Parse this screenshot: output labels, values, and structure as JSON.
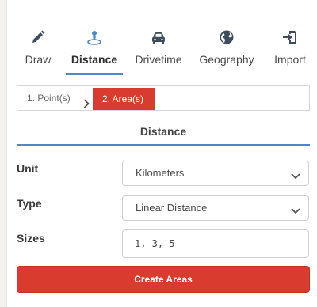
{
  "tabs": [
    {
      "label": "Draw",
      "icon": "pencil-icon"
    },
    {
      "label": "Distance",
      "icon": "map-pin-icon",
      "active": true
    },
    {
      "label": "Drivetime",
      "icon": "car-icon"
    },
    {
      "label": "Geography",
      "icon": "globe-icon"
    },
    {
      "label": "Import",
      "icon": "import-icon"
    }
  ],
  "steps": {
    "step1": "1. Point(s)",
    "step2": "2. Area(s)"
  },
  "section": {
    "title": "Distance"
  },
  "form": {
    "unit_label": "Unit",
    "unit_value": "Kilometers",
    "type_label": "Type",
    "type_value": "Linear Distance",
    "sizes_label": "Sizes",
    "sizes_value": "1, 3, 5"
  },
  "actions": {
    "create_label": "Create Areas"
  },
  "colors": {
    "accent_blue": "#4a8ac9",
    "action_red": "#d93b2e"
  }
}
